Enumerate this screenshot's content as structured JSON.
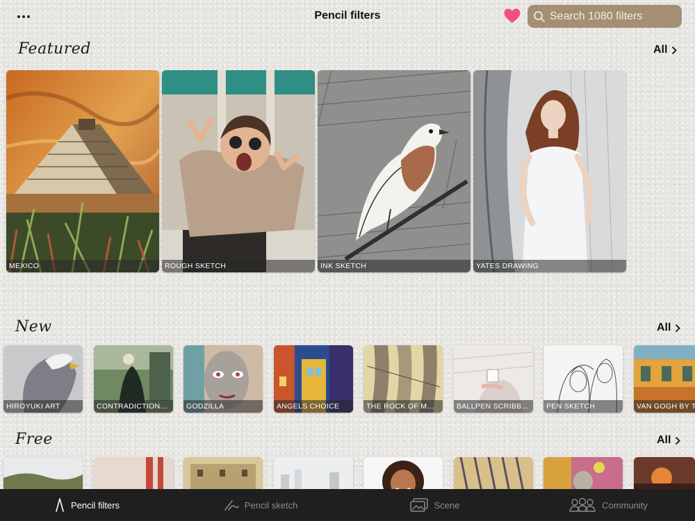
{
  "header": {
    "title": "Pencil filters",
    "search_placeholder": "Search 1080 filters",
    "icons": [
      "more-dots-icon",
      "heart-icon",
      "search-icon"
    ],
    "accent_color": "#a48f75",
    "heart_color": "#f0507a"
  },
  "featured": {
    "title": "Featured",
    "all_label": "All",
    "items": [
      {
        "label": "MEXICO"
      },
      {
        "label": "ROUGH SKETCH"
      },
      {
        "label": "INK SKETCH"
      },
      {
        "label": "YATES DRAWING"
      }
    ]
  },
  "new": {
    "title": "New",
    "all_label": "All",
    "items": [
      {
        "label": "HIROYUKI ART"
      },
      {
        "label": "CONTRADICTIONS C..."
      },
      {
        "label": "GODZILLA"
      },
      {
        "label": "ANGELS CHOICE"
      },
      {
        "label": "THE ROCK OF MONT..."
      },
      {
        "label": "BALLPEN SCRIBBLE"
      },
      {
        "label": "PEN SKETCH"
      },
      {
        "label": "VAN GOGH BY TO"
      }
    ]
  },
  "free": {
    "title": "Free",
    "all_label": "All"
  },
  "tabbar": {
    "tabs": [
      {
        "label": "Pencil filters",
        "icon": "pencil-icon",
        "active": true
      },
      {
        "label": "Pencil sketch",
        "icon": "scribble-icon",
        "active": false
      },
      {
        "label": "Scene",
        "icon": "photos-icon",
        "active": false
      },
      {
        "label": "Community",
        "icon": "people-icon",
        "active": false
      }
    ]
  }
}
